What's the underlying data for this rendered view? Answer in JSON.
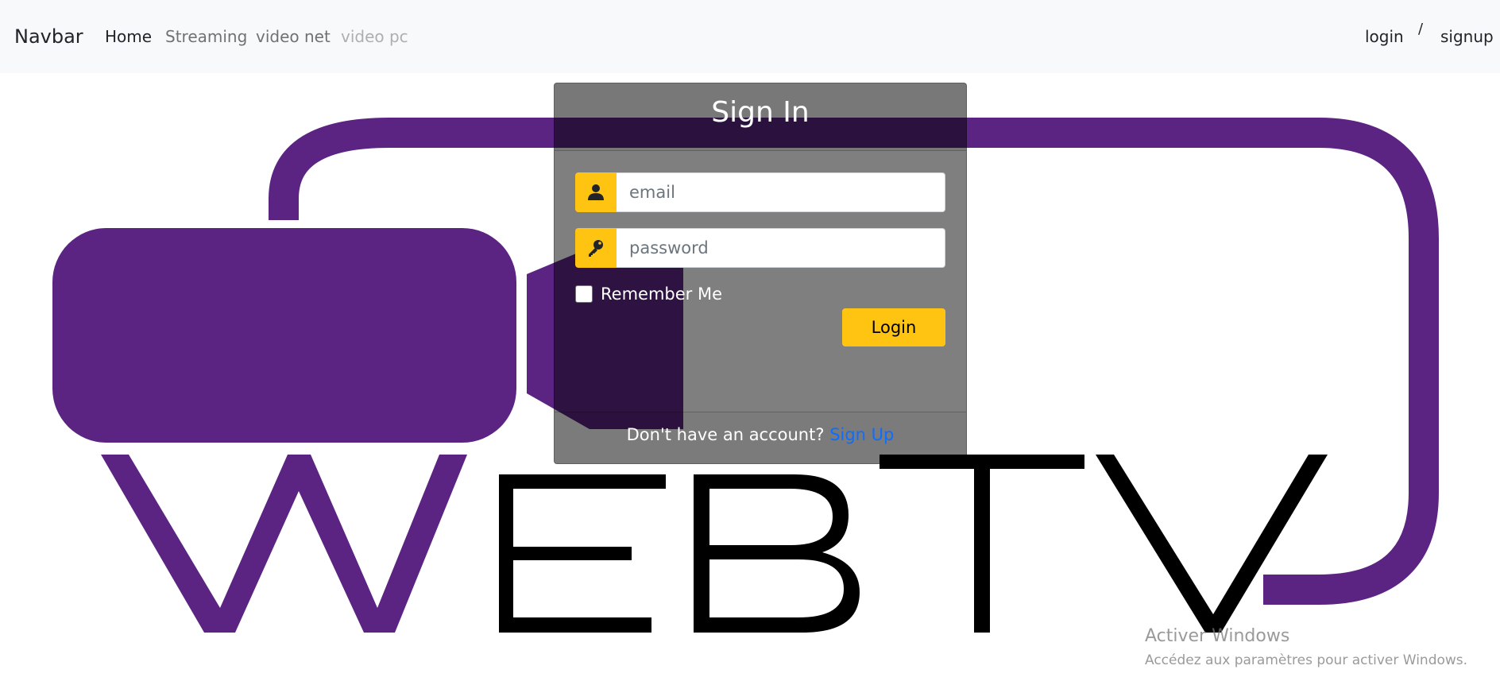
{
  "navbar": {
    "brand": "Navbar",
    "links": [
      {
        "label": "Home",
        "state": "active"
      },
      {
        "label": "Streaming",
        "state": "normal"
      },
      {
        "label": "video net",
        "state": "normal"
      },
      {
        "label": "video pc",
        "state": "disabled"
      }
    ],
    "login_label": "login",
    "separator": "/",
    "signup_label": "signup"
  },
  "logo": {
    "text": "WEBTV",
    "colors": {
      "purple": "#5c2482",
      "black": "#000000"
    }
  },
  "signin": {
    "title": "Sign In",
    "email": {
      "placeholder": "email",
      "icon": "user-icon"
    },
    "password": {
      "placeholder": "password",
      "icon": "key-icon"
    },
    "remember_label": "Remember Me",
    "login_button": "Login",
    "footer_text": "Don't have an account?",
    "signup_link": "Sign Up",
    "accent_color": "#ffc312",
    "link_color": "#0d6efd"
  },
  "watermark": {
    "title": "Activer Windows",
    "subtitle": "Accédez aux paramètres pour activer Windows."
  }
}
